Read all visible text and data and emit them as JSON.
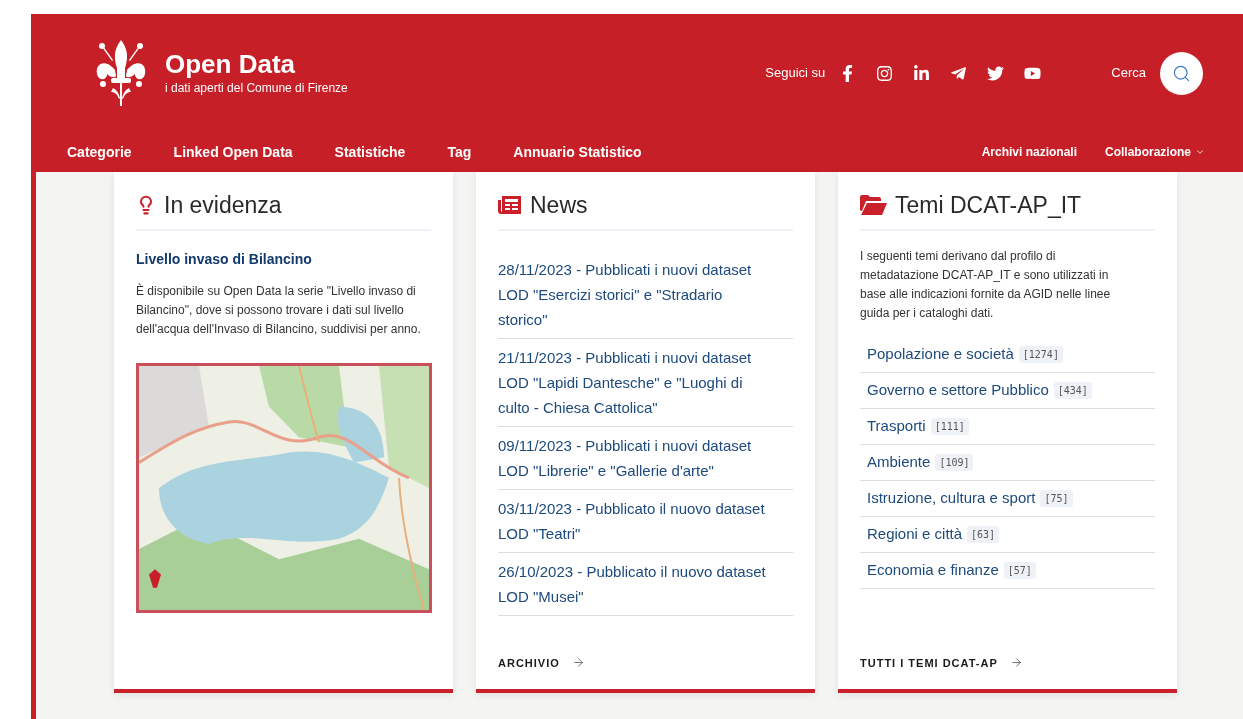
{
  "header": {
    "title": "Open Data",
    "subtitle": "i dati aperti del Comune di Firenze",
    "follow_label": "Seguici su",
    "social": [
      {
        "kind": "facebook"
      },
      {
        "kind": "instagram"
      },
      {
        "kind": "linkedin"
      },
      {
        "kind": "telegram"
      },
      {
        "kind": "twitter"
      },
      {
        "kind": "youtube"
      }
    ],
    "search_label": "Cerca"
  },
  "nav": {
    "left": [
      "Categorie",
      "Linked Open Data",
      "Statistiche",
      "Tag",
      "Annuario Statistico"
    ],
    "right": [
      {
        "label": "Archivi nazionali",
        "dropdown": false
      },
      {
        "label": "Collaborazione",
        "dropdown": true
      }
    ]
  },
  "highlight": {
    "title": "In evidenza",
    "item_title": "Livello invaso di Bilancino",
    "text": "È disponibile su Open Data la serie \"Livello invaso di Bilancino\", dove si possono trovare i dati sul livello dell'acqua dell'Invaso di Bilancino, suddivisi per anno."
  },
  "news": {
    "title": "News",
    "items": [
      "28/11/2023 - Pubblicati i nuovi dataset LOD \"Esercizi storici\" e \"Stradario storico\"",
      "21/11/2023 - Pubblicati i nuovi dataset LOD \"Lapidi Dantesche\" e \"Luoghi di culto - Chiesa Cattolica\"",
      "09/11/2023 - Pubblicati i nuovi dataset LOD \"Librerie\" e \"Gallerie d'arte\"",
      "03/11/2023 - Pubblicato il nuovo dataset LOD \"Teatri\"",
      "26/10/2023 - Pubblicato il nuovo dataset LOD \"Musei\""
    ],
    "link": "ARCHIVIO"
  },
  "themes": {
    "title": "Temi DCAT-AP_IT",
    "intro": "I seguenti temi derivano dal profilo di metadatazione DCAT-AP_IT e sono utilizzati in base alle indicazioni fornite da AGID nelle linee guida per i cataloghi dati.",
    "items": [
      {
        "label": "Popolazione e società",
        "count": "[1274]"
      },
      {
        "label": "Governo e settore Pubblico",
        "count": "[434]"
      },
      {
        "label": "Trasporti",
        "count": "[111]"
      },
      {
        "label": "Ambiente",
        "count": "[109]"
      },
      {
        "label": "Istruzione, cultura e sport",
        "count": "[75]"
      },
      {
        "label": "Regioni e città",
        "count": "[63]"
      },
      {
        "label": "Economia e finanze",
        "count": "[57]"
      }
    ],
    "link": "TUTTI I TEMI DCAT-AP"
  }
}
